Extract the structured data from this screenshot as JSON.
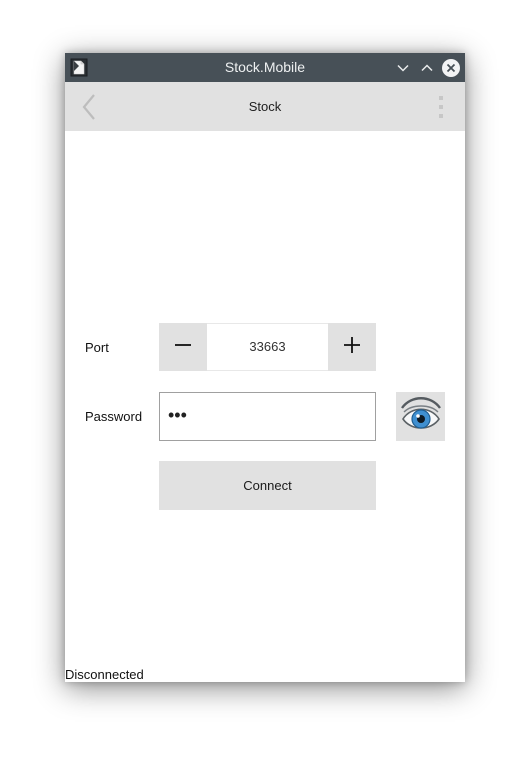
{
  "window": {
    "title": "Stock.Mobile",
    "icons": {
      "app": "app-document-icon",
      "minimize": "chevron-down-icon",
      "maximize": "chevron-up-icon",
      "close": "close-circle-icon"
    }
  },
  "appbar": {
    "title": "Stock",
    "back_icon": "chevron-left-icon",
    "more_icon": "more-vertical-icon"
  },
  "form": {
    "port": {
      "label": "Port",
      "value": "33663",
      "decrement_icon": "minus-icon",
      "increment_icon": "plus-icon"
    },
    "password": {
      "label": "Password",
      "masked_value": "•••",
      "toggle_icon": "eye-icon"
    },
    "connect_label": "Connect"
  },
  "status": {
    "text": "Disconnected"
  },
  "colors": {
    "titlebar": "#475057",
    "appbar": "#e1e1e1",
    "button": "#e1e1e1",
    "field_border": "#a0a0a0"
  }
}
